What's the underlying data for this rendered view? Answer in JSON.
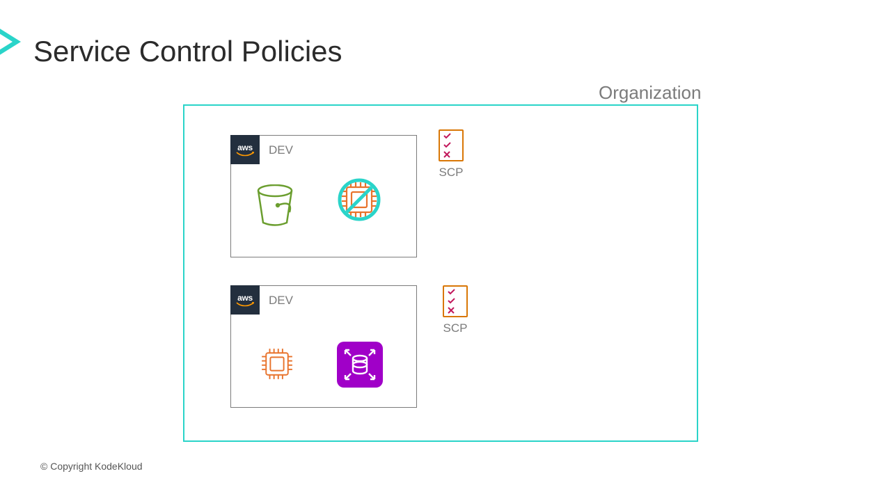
{
  "title": "Service Control Policies",
  "org_label": "Organization",
  "accounts": [
    {
      "label": "DEV",
      "aws": "aws"
    },
    {
      "label": "DEV",
      "aws": "aws"
    }
  ],
  "scp": [
    {
      "label": "SCP"
    },
    {
      "label": "SCP"
    }
  ],
  "copyright": "© Copyright KodeKloud",
  "icons": {
    "bucket": "s3-bucket-icon",
    "chip_prohibited": "ec2-chip-prohibited-icon",
    "chip": "ec2-chip-icon",
    "db_scale": "rds-autoscale-icon",
    "scp_list": "scp-policy-icon"
  }
}
